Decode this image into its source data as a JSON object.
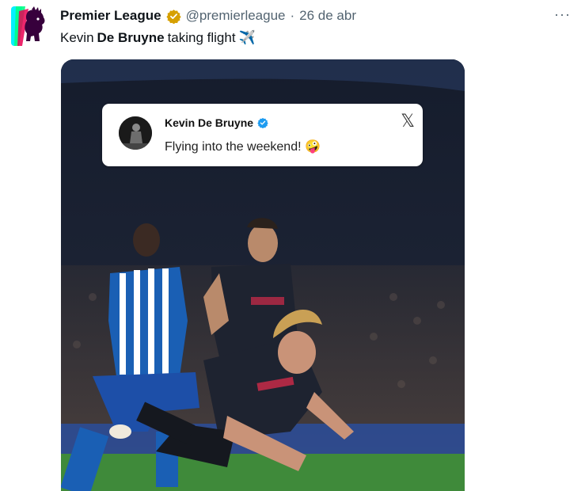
{
  "tweet": {
    "author_name": "Premier League",
    "author_handle": "@premierleague",
    "separator": "·",
    "date": "26 de abr",
    "more_label": "···",
    "text_prefix": "Kevin",
    "text_bold": "De Bruyne",
    "text_suffix": "taking flight",
    "plane_emoji": "✈️"
  },
  "embedded_post": {
    "author_name": "Kevin De Bruyne",
    "text": "Flying into the weekend! 🤪",
    "platform_logo": "𝕏"
  },
  "colors": {
    "verified_gold": "#d6a000",
    "verified_blue": "#1d9bf0",
    "handle_gray": "#536471",
    "brighton_blue": "#1a5fb4",
    "city_kit": "#1e2330",
    "pitch_green": "#3f8a3a"
  },
  "icons": [
    "premier-league-lion-icon",
    "verified-gold-icon",
    "more-icon",
    "airplane-icon",
    "verified-blue-icon",
    "x-logo-icon"
  ]
}
